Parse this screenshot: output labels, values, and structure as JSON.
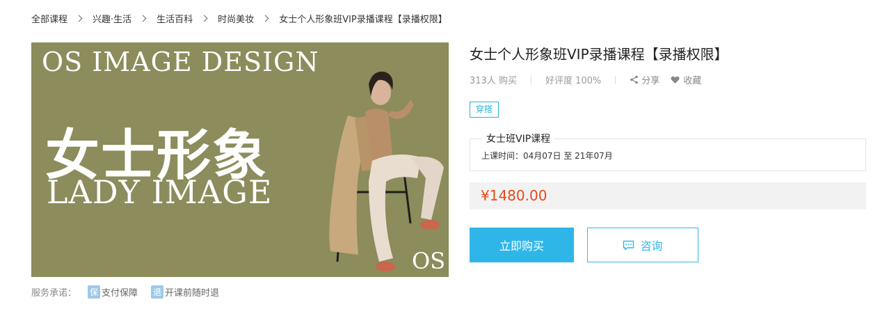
{
  "breadcrumb": [
    "全部课程",
    "兴趣·生活",
    "生活百科",
    "时尚美妆",
    "女士个人形象班VIP录播课程【录播权限】"
  ],
  "hero": {
    "title_top": "OS IMAGE DESIGN",
    "title_cn": "女士形象",
    "title_en": "LADY IMAGE",
    "logo": "OS",
    "bg_color": "#8c8c5c"
  },
  "services": {
    "label": "服务承诺：",
    "items": [
      {
        "icon": "保",
        "text": "支付保障"
      },
      {
        "icon": "退",
        "text": "开课前随时退"
      }
    ]
  },
  "product": {
    "title": "女士个人形象班VIP录播课程【录播权限】",
    "buyers": "313人 购买",
    "rating": "好评度 100%",
    "share": "分享",
    "favorite": "收藏",
    "tag": "穿搭",
    "course_name": "女士班VIP课程",
    "course_time": "上课时间：04月07日 至 21年07月",
    "price": "¥1480.00"
  },
  "actions": {
    "buy": "立即购买",
    "consult": "咨询"
  },
  "colors": {
    "accent": "#2fb6e8",
    "price": "#e84a1a"
  }
}
